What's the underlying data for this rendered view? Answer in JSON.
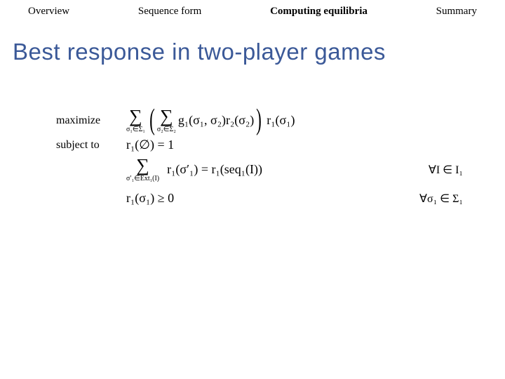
{
  "nav": {
    "overview": "Overview",
    "sequence_form": "Sequence form",
    "computing_equilibria": "Computing equilibria",
    "summary": "Summary"
  },
  "title": "Best response in two-player games",
  "lp": {
    "maximize_label": "maximize",
    "subject_to_label": "subject to",
    "sum1_sub": "σ₁∈Σ₁",
    "sum2_sub": "σ₂∈Σ₂",
    "obj_inner": "g₁(σ₁, σ₂)r₂(σ₂)",
    "obj_tail": "r₁(σ₁)",
    "eq1": "r₁(∅) = 1",
    "sum3_sub": "σ′₁∈Ext₁(I)",
    "eq2_lhs": "r₁(σ′₁) = r₁(seq₁(I))",
    "eq2_cond": "∀I ∈ I₁",
    "eq3": "r₁(σ₁) ≥ 0",
    "eq3_cond": "∀σ₁ ∈ Σ₁"
  }
}
